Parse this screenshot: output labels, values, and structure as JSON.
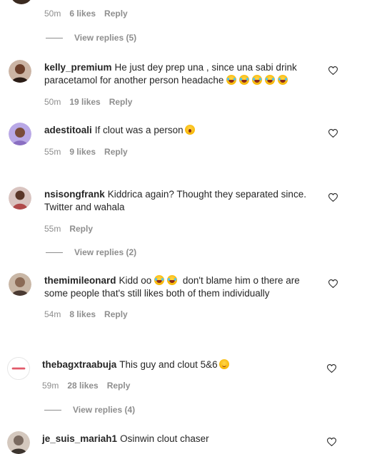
{
  "top_partial": {
    "time": "50m",
    "likes": "6 likes",
    "reply": "Reply",
    "view_replies": "View replies (5)"
  },
  "comments": [
    {
      "username": "kelly_premium",
      "text": "He just dey prep una , since una sabi drink paracetamol for another person headache",
      "emojis": [
        "laugh",
        "laugh",
        "laugh",
        "laugh",
        "laugh"
      ],
      "time": "50m",
      "likes": "19 likes",
      "reply": "Reply",
      "avatar_color": "#6b3e2a"
    },
    {
      "username": "adestitoali",
      "text": "If clout was a person",
      "emojis": [
        "wow"
      ],
      "time": "55m",
      "likes": "9 likes",
      "reply": "Reply",
      "avatar_color": "#8a6fc2"
    },
    {
      "username": "nsisongfrank",
      "text": "Kiddrica again? Thought they separated since. Twitter and wahala",
      "time": "55m",
      "likes": "",
      "reply": "Reply",
      "view_replies": "View replies (2)",
      "avatar_color": "#b04a4a"
    },
    {
      "username": "themimileonard",
      "text_before": "Kidd oo",
      "emojis": [
        "laugh",
        "laugh"
      ],
      "text": "don't blame him o there are some people that's still likes both of them individually",
      "time": "54m",
      "likes": "8 likes",
      "reply": "Reply",
      "avatar_color": "#8b6a55"
    },
    {
      "username": "thebagxtraabuja",
      "text": "This guy and clout 5&6",
      "emojis": [
        "smirk"
      ],
      "time": "59m",
      "likes": "28 likes",
      "reply": "Reply",
      "view_replies": "View replies (4)",
      "avatar_color": "#f2f2f2"
    },
    {
      "username": "je_suis_mariah1",
      "text": "Osinwin clout chaser",
      "avatar_color": "#7a6a60"
    }
  ],
  "colors": {
    "text": "#262626",
    "meta": "#8e8e8e",
    "background": "#ffffff"
  },
  "icons": {
    "like": "heart-outline-icon"
  }
}
